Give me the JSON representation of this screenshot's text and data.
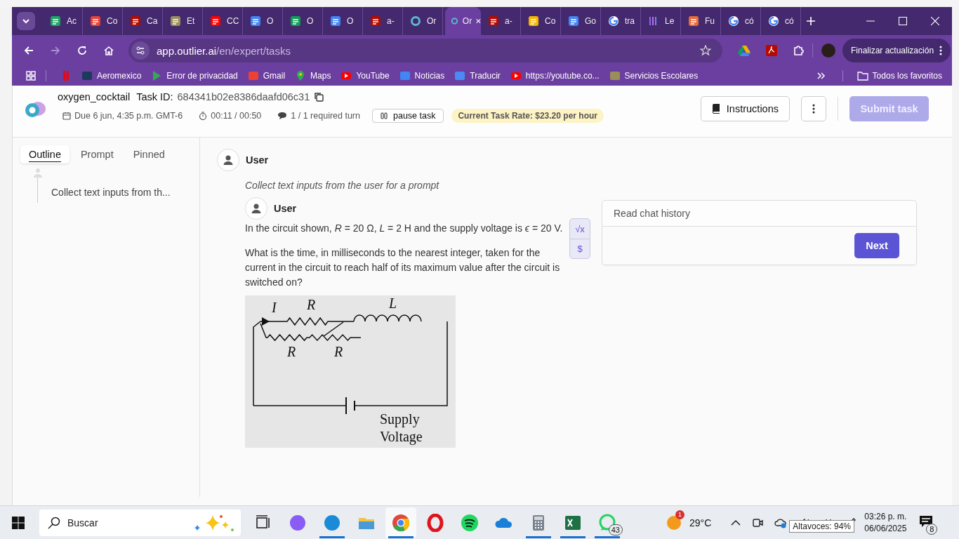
{
  "browser": {
    "tabs": [
      {
        "kind": "drive",
        "label": "Ac",
        "selected": false
      },
      {
        "kind": "gmail",
        "label": "Co",
        "selected": false
      },
      {
        "kind": "pdf",
        "label": "Ca",
        "selected": false
      },
      {
        "kind": "seal",
        "label": "Et",
        "selected": false
      },
      {
        "kind": "youtube",
        "label": "CC",
        "selected": false
      },
      {
        "kind": "docs",
        "label": "O",
        "selected": false
      },
      {
        "kind": "sheets",
        "label": "O",
        "selected": false
      },
      {
        "kind": "docs",
        "label": "O",
        "selected": false
      },
      {
        "kind": "pdf",
        "label": "a-",
        "selected": false
      },
      {
        "kind": "outlier",
        "label": "Or",
        "selected": false
      },
      {
        "kind": "outlier",
        "label": "Or",
        "selected": true
      },
      {
        "kind": "pdf",
        "label": "a-",
        "selected": false
      },
      {
        "kind": "slides",
        "label": "Co",
        "selected": false
      },
      {
        "kind": "docs",
        "label": "Go",
        "selected": false
      },
      {
        "kind": "google",
        "label": "tra",
        "selected": false
      },
      {
        "kind": "bars",
        "label": "Le",
        "selected": false
      },
      {
        "kind": "figma",
        "label": "Fu",
        "selected": false
      },
      {
        "kind": "google",
        "label": "có",
        "selected": false
      },
      {
        "kind": "google",
        "label": "có",
        "selected": false
      }
    ],
    "address": {
      "host": "app.outlier.ai",
      "path": "/en/expert/tasks"
    },
    "update_button": "Finalizar actualización",
    "bookmarks": [
      {
        "kind": "netflix"
      },
      {
        "kind": "bird",
        "label": "Aeromexico"
      },
      {
        "kind": "play",
        "label": "Error de privacidad"
      },
      {
        "kind": "gmail",
        "label": "Gmail"
      },
      {
        "kind": "maps",
        "label": "Maps"
      },
      {
        "kind": "youtube",
        "label": "YouTube"
      },
      {
        "kind": "news",
        "label": "Noticias"
      },
      {
        "kind": "translate",
        "label": "Traducir"
      },
      {
        "kind": "youtube",
        "label": "https://youtube.co..."
      },
      {
        "kind": "seal",
        "label": "Servicios Escolares"
      }
    ],
    "all_bookmarks": "Todos los favoritos"
  },
  "header": {
    "project": "oxygen_cocktail",
    "task_id_label": "Task ID:",
    "task_id": "684341b02e8386daafd06c31",
    "due": "Due 6 jun, 4:35 p.m. GMT-6",
    "timer": "00:11 / 00:50",
    "turns": "1 / 1 required turn",
    "pause_button": "pause task",
    "rate": "Current Task Rate: $23.20 per hour",
    "instructions_button": "Instructions",
    "submit_button": {
      "label": "Submit task",
      "disabled": true
    }
  },
  "sidebar": {
    "tabs": [
      {
        "label": "Outline",
        "selected": true
      },
      {
        "label": "Prompt",
        "selected": false
      },
      {
        "label": "Pinned",
        "selected": false
      }
    ],
    "outline": [
      {
        "text": "Collect text inputs from th..."
      }
    ]
  },
  "conversation": [
    {
      "author": "User",
      "note": "Collect text inputs from the user for a prompt"
    },
    {
      "author": "User",
      "paragraphs": [
        "In the circuit shown, *R* = 20 Ω, *L* = 2 H and the supply voltage is *ϵ* = 20 V.",
        "What is the time, in milliseconds to the nearest integer, taken for the current in the circuit to reach half of its maximum value after the circuit is switched on?"
      ],
      "figure_labels": [
        "I",
        "R",
        "L",
        "R",
        "R",
        "Supply",
        "Voltage"
      ]
    }
  ],
  "editor_tools": [
    "√x",
    "$"
  ],
  "chat_panel": {
    "placeholder": "Read chat history",
    "next_button": "Next"
  },
  "taskbar": {
    "search_placeholder": "Buscar",
    "apps": [
      {
        "kind": "taskview",
        "running": false,
        "selected": false
      },
      {
        "kind": "copilot",
        "running": false,
        "selected": false
      },
      {
        "kind": "edge",
        "running": true,
        "selected": false
      },
      {
        "kind": "files",
        "running": false,
        "selected": false
      },
      {
        "kind": "chrome",
        "running": true,
        "selected": true
      },
      {
        "kind": "opera",
        "running": false,
        "selected": false
      },
      {
        "kind": "spotify",
        "running": false,
        "selected": false
      },
      {
        "kind": "onedrive",
        "running": false,
        "selected": false
      },
      {
        "kind": "calculator",
        "running": true,
        "selected": false
      },
      {
        "kind": "excel",
        "running": true,
        "selected": false
      },
      {
        "kind": "whatsapp",
        "running": true,
        "selected": false,
        "badge": "43"
      }
    ],
    "weather_badge": "1",
    "temperature": "29°C",
    "tooltip": "Altavoces: 94%",
    "time": "03:26 p. m.",
    "date": "06/06/2025",
    "notifications": "8"
  }
}
